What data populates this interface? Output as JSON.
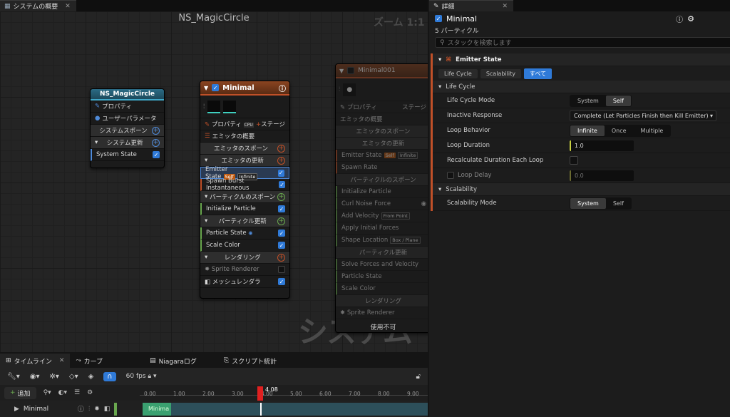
{
  "graph_tab": {
    "title": "システムの概要"
  },
  "graph": {
    "title": "NS_MagicCircle",
    "zoom": "ズーム 1:1",
    "watermark": "システム"
  },
  "sys_node": {
    "title": "NS_MagicCircle",
    "rows": [
      "プロパティ",
      "ユーザーパラメータ",
      "システムスポーン",
      "システム更新",
      "System State"
    ]
  },
  "emitter": {
    "title": "Minimal",
    "props": "プロパティ",
    "stage": "ステージ",
    "summary": "エミッタの概要",
    "spawn": "エミッタのスポーン",
    "update": "エミッタの更新",
    "state": "Emitter State",
    "self": "Self",
    "infinite": "Infinite",
    "burst": "Spawn Burst Instantaneous",
    "pspawn": "パーティクルのスポーン",
    "init": "Initialize Particle",
    "pupdate": "パーティクル更新",
    "pstate": "Particle State",
    "scale": "Scale Color",
    "render": "レンダリング",
    "sprite": "Sprite Renderer",
    "mesh": "メッシュレンダラ"
  },
  "emitter2": {
    "title": "Minimal001",
    "props": "プロパティ",
    "stage": "ステージ",
    "summary": "エミッタの概要",
    "spawn": "エミッタのスポーン",
    "update": "エミッタの更新",
    "state": "Emitter State",
    "self": "Self",
    "infinite": "Infinite",
    "spawnrate": "Spawn Rate",
    "pspawn": "パーティクルのスポーン",
    "init": "Initialize Particle",
    "curl": "Curl Noise Force",
    "addv": "Add Velocity",
    "frompoint": "From Point",
    "apply": "Apply Initial Forces",
    "shape": "Shape Location",
    "boxplane": "Box / Plane",
    "pupdate": "パーティクル更新",
    "solve": "Solve Forces and Velocity",
    "pstate": "Particle State",
    "scale": "Scale Color",
    "render": "レンダリング",
    "sprite": "Sprite Renderer",
    "disabled": "使用不可"
  },
  "timeline": {
    "tabs": [
      "タイムライン",
      "カーブ",
      "Niagaraログ",
      "スクリプト統計"
    ],
    "add": "追加",
    "fps": "60 fps",
    "current": "4.08",
    "ticks": [
      "0.00",
      "1.00",
      "2.00",
      "3.00",
      "4.00",
      "5.00",
      "6.00",
      "7.00",
      "8.00",
      "9.00"
    ],
    "track": "Minimal",
    "bar_label": "Minima"
  },
  "details": {
    "tab": "詳細",
    "name": "Minimal",
    "count": "5 パーティクル",
    "search_placeholder": "スタックを検索します",
    "section": "Emitter State",
    "filters": [
      "Life Cycle",
      "Scalability",
      "すべて"
    ],
    "lifecycle": "Life Cycle",
    "mode_label": "Life Cycle Mode",
    "mode_opts": [
      "System",
      "Self"
    ],
    "inactive_label": "Inactive Response",
    "inactive_val": "Complete (Let Particles Finish then Kill Emitter)",
    "loop_label": "Loop Behavior",
    "loop_opts": [
      "Infinite",
      "Once",
      "Multiple"
    ],
    "dur_label": "Loop Duration",
    "dur_val": "1.0",
    "recalc_label": "Recalculate Duration Each Loop",
    "delay_label": "Loop Delay",
    "delay_val": "0.0",
    "scal": "Scalability",
    "scal_label": "Scalability Mode",
    "scal_opts": [
      "System",
      "Self"
    ]
  },
  "colors": {
    "accent": "#2f7ad8",
    "emitter": "#c05028",
    "green": "#6aa84f"
  }
}
